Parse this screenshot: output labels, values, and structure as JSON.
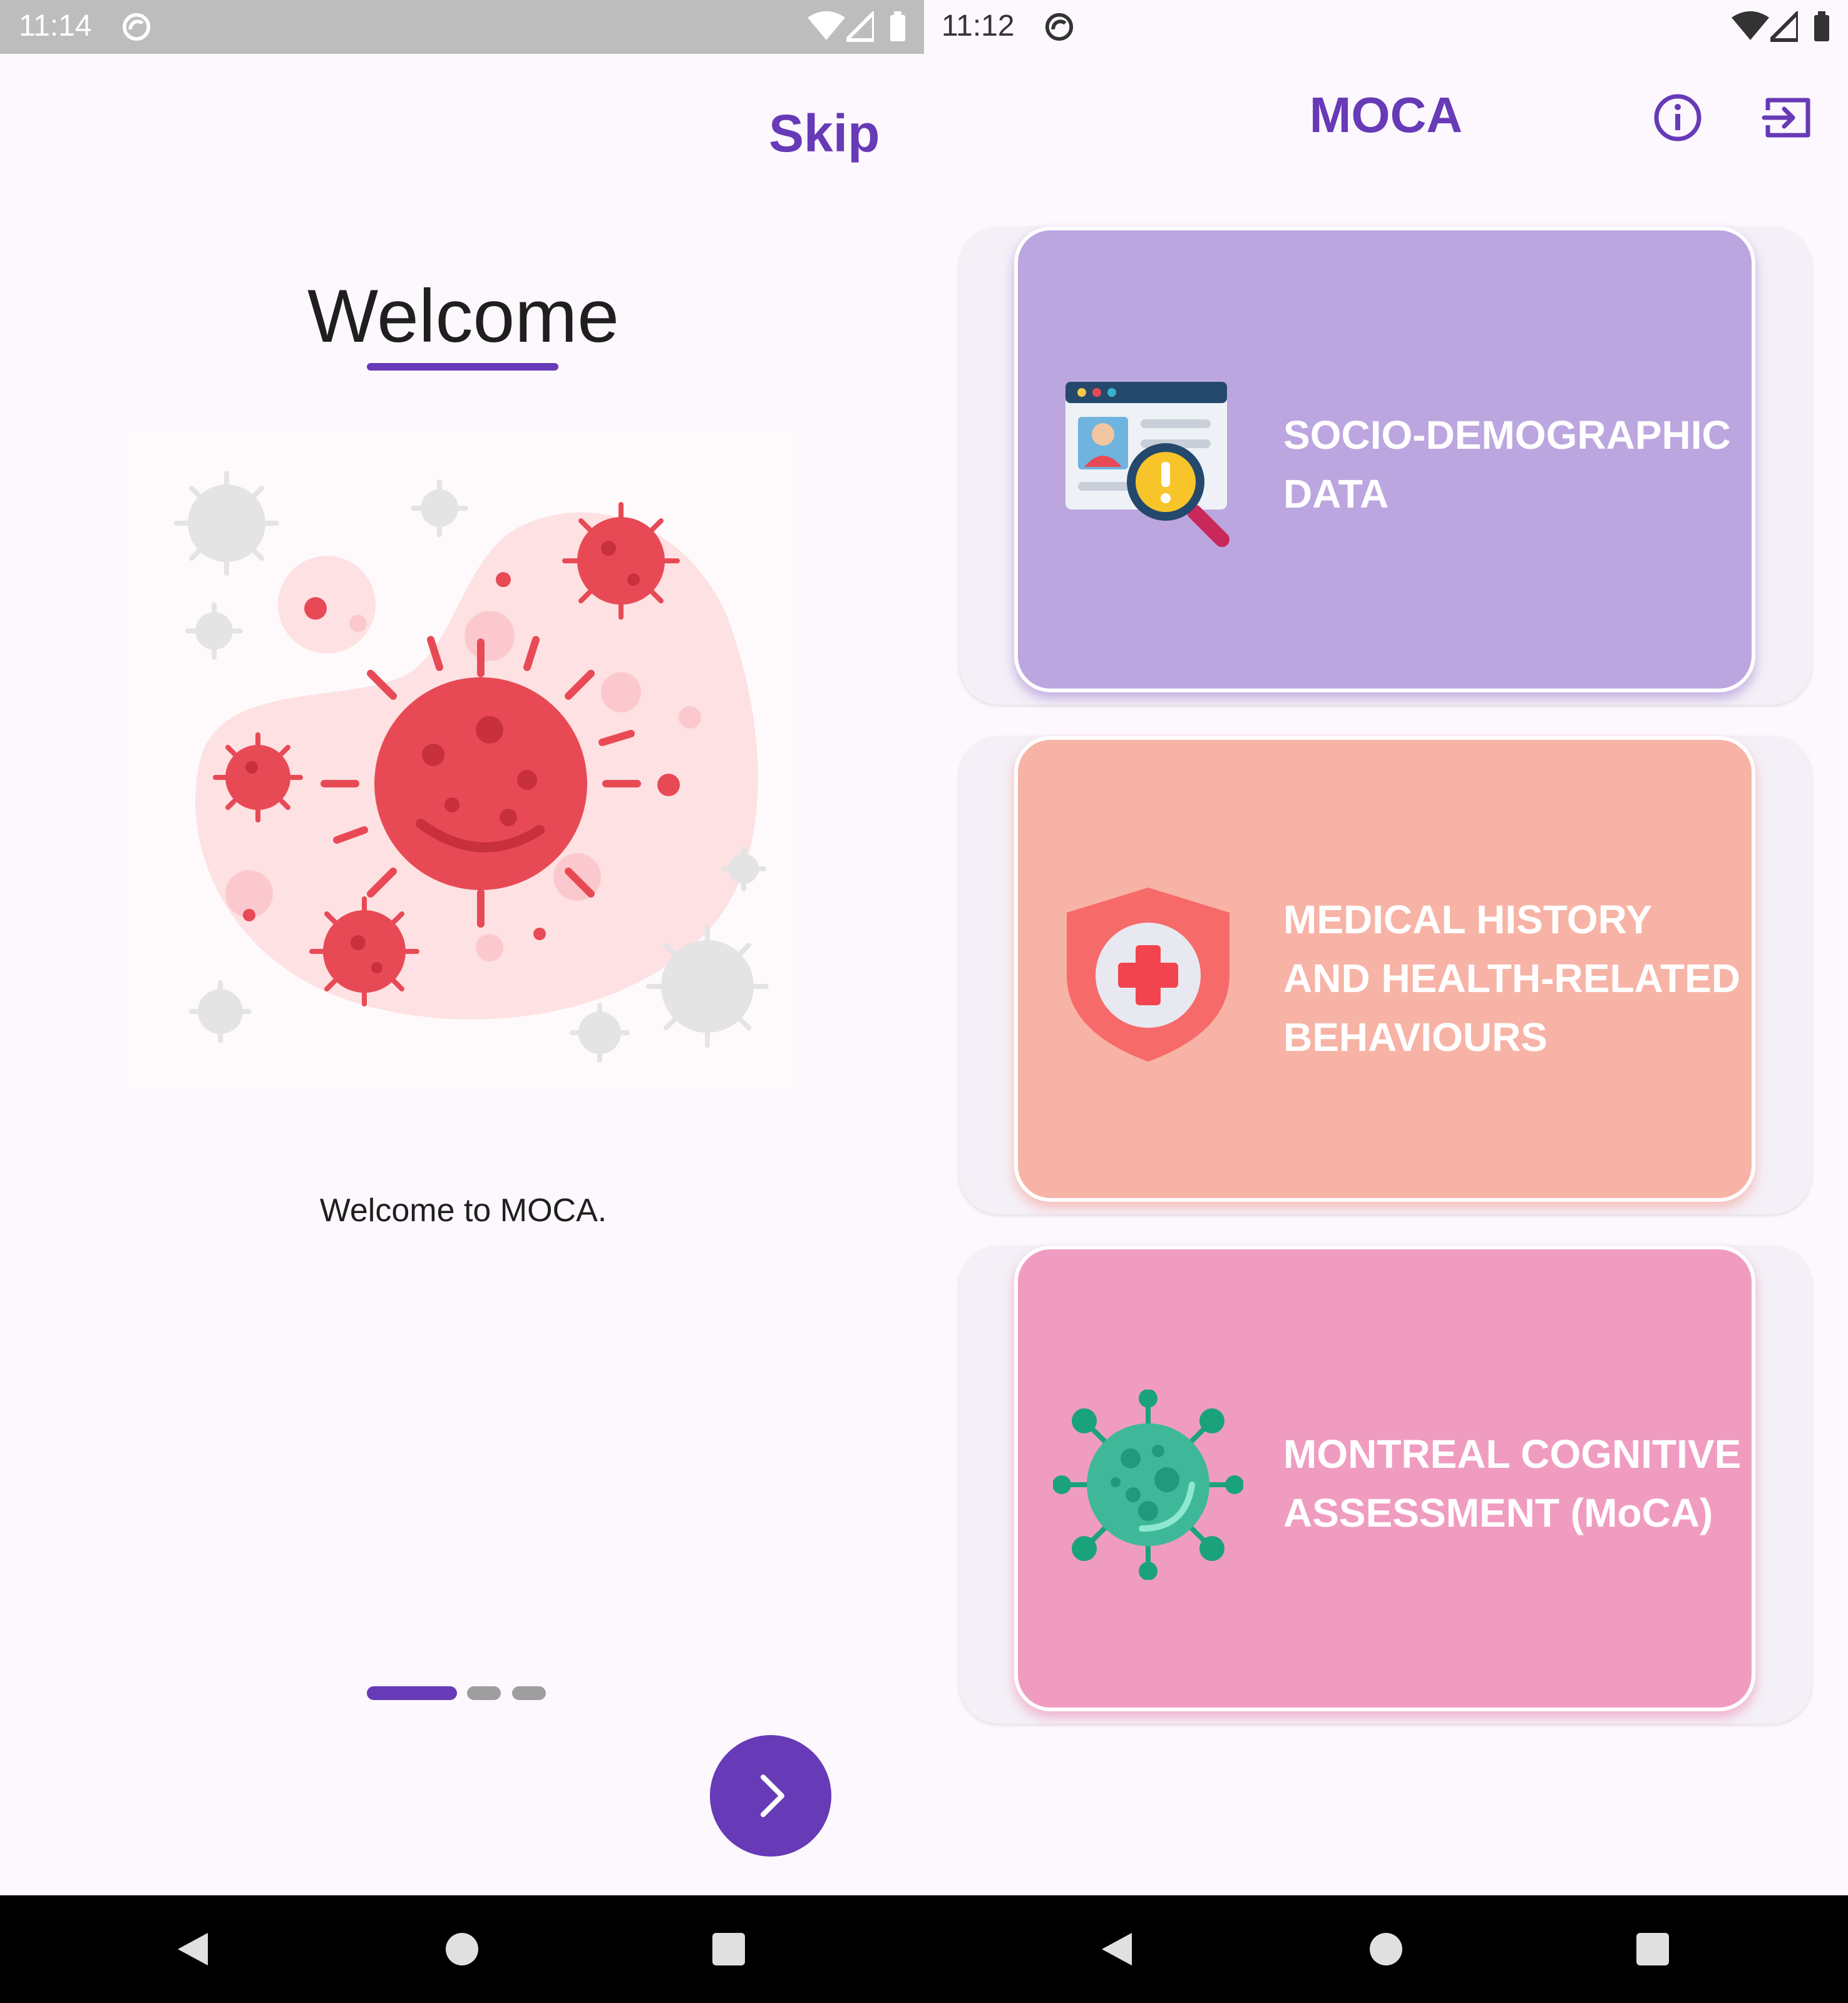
{
  "left_screen": {
    "status_bar": {
      "time": "11:14"
    },
    "skip_label": "Skip",
    "title": "Welcome",
    "welcome_text": "Welcome to MOCA.",
    "pager": {
      "pages": 3,
      "active_index": 0
    }
  },
  "right_screen": {
    "status_bar": {
      "time": "11:12"
    },
    "app_title": "MOCA",
    "cards": [
      {
        "label": "SOCIO-DEMOGRAPHIC DATA",
        "lines": [
          "SOCIO-DEMOGRAPHIC",
          "DATA"
        ],
        "icon": "id-card-search-icon",
        "color": "#bca6df"
      },
      {
        "label": "MEDICAL HISTORY AND HEALTH-RELATED BEHAVIOURS",
        "lines": [
          "MEDICAL HISTORY",
          "AND HEALTH-RELATED",
          "BEHAVIOURS"
        ],
        "icon": "medical-shield-icon",
        "color": "#f7b3a6"
      },
      {
        "label": "MONTREAL COGNITIVE ASSESSMENT (MoCA)",
        "lines": [
          "MONTREAL COGNITIVE",
          "ASSESSMENT (MoCA)"
        ],
        "icon": "virus-icon",
        "color": "#f09cc0"
      }
    ]
  },
  "colors": {
    "primary": "#673ab7",
    "background": "#fdf8fd"
  }
}
